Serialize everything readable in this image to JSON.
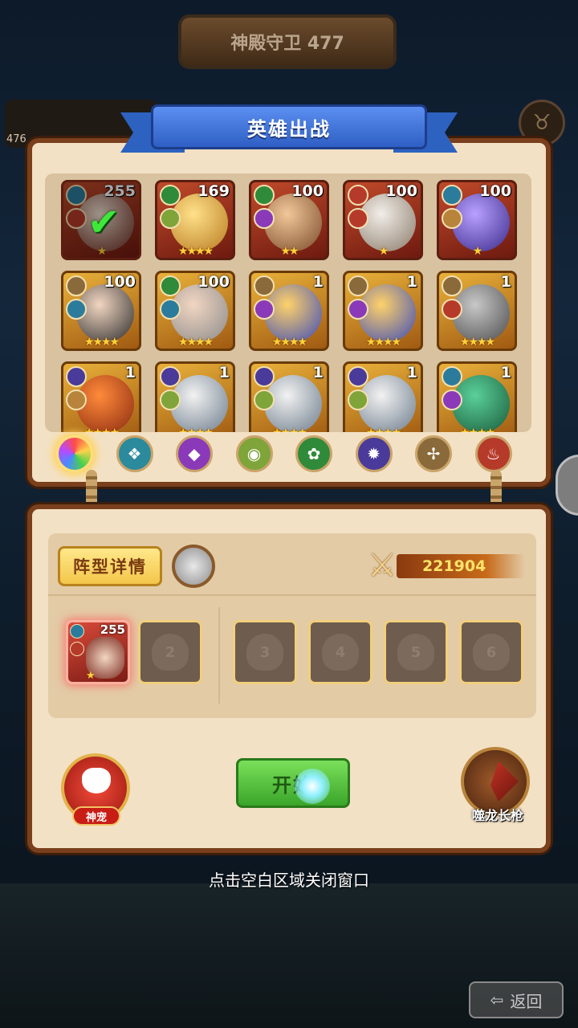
{
  "stage_title": "神殿守卫 477",
  "top_left_value": "476",
  "panel_title": "英雄出战",
  "heroes": [
    {
      "level": "255",
      "stars": "★",
      "selected": true,
      "frame": "red",
      "fac": "#2b7c9c",
      "cls": "#b63a2a",
      "pc1": "#f0e0d0",
      "pc2": "#6a2a20"
    },
    {
      "level": "169",
      "stars": "★★★★",
      "selected": false,
      "frame": "red",
      "fac": "#2f8a3a",
      "cls": "#7ea43a",
      "pc1": "#ffe18a",
      "pc2": "#b87a20"
    },
    {
      "level": "100",
      "stars": "★★",
      "selected": false,
      "frame": "red",
      "fac": "#2f8a3a",
      "cls": "#8a3ab8",
      "pc1": "#f1c89a",
      "pc2": "#7a4a2a"
    },
    {
      "level": "100",
      "stars": "★",
      "selected": false,
      "frame": "red",
      "fac": "#b63a2a",
      "cls": "#b63a2a",
      "pc1": "#f2eee8",
      "pc2": "#8a7a6a"
    },
    {
      "level": "100",
      "stars": "★",
      "selected": false,
      "frame": "red",
      "fac": "#2b7c9c",
      "cls": "#b8833a",
      "pc1": "#b8a0ff",
      "pc2": "#3a2a8a"
    },
    {
      "level": "100",
      "stars": "★★★★",
      "selected": false,
      "frame": "gold",
      "fac": "#8a6a3a",
      "cls": "#2b7c9c",
      "pc1": "#f2d6c2",
      "pc2": "#2a2a2a"
    },
    {
      "level": "100",
      "stars": "★★★★",
      "selected": false,
      "frame": "gold",
      "fac": "#2f8a3a",
      "cls": "#2b7c9c",
      "pc1": "#f2d6c2",
      "pc2": "#8a8a8a"
    },
    {
      "level": "1",
      "stars": "★★★★",
      "selected": false,
      "frame": "gold",
      "fac": "#8a6a3a",
      "cls": "#8a3ab8",
      "pc1": "#ffd26a",
      "pc2": "#3a4ab8"
    },
    {
      "level": "1",
      "stars": "★★★★",
      "selected": false,
      "frame": "gold",
      "fac": "#8a6a3a",
      "cls": "#8a3ab8",
      "pc1": "#ffd26a",
      "pc2": "#3a4ab8"
    },
    {
      "level": "1",
      "stars": "★★★★",
      "selected": false,
      "frame": "gold",
      "fac": "#8a6a3a",
      "cls": "#b63a2a",
      "pc1": "#c8c8c8",
      "pc2": "#4a4a4a"
    },
    {
      "level": "1",
      "stars": "★★★★",
      "selected": false,
      "frame": "gold",
      "fac": "#4a3a9a",
      "cls": "#b8833a",
      "pc1": "#ff8a3a",
      "pc2": "#8a2a10"
    },
    {
      "level": "1",
      "stars": "★★★★",
      "selected": false,
      "frame": "gold",
      "fac": "#4a3a9a",
      "cls": "#7ea43a",
      "pc1": "#f2f2f2",
      "pc2": "#6a7a8a"
    },
    {
      "level": "1",
      "stars": "★★★★",
      "selected": false,
      "frame": "gold",
      "fac": "#4a3a9a",
      "cls": "#7ea43a",
      "pc1": "#f2f2f2",
      "pc2": "#6a7a8a"
    },
    {
      "level": "1",
      "stars": "★★★★",
      "selected": false,
      "frame": "gold",
      "fac": "#4a3a9a",
      "cls": "#7ea43a",
      "pc1": "#f2f2f2",
      "pc2": "#6a7a8a"
    },
    {
      "level": "1",
      "stars": "★★★★",
      "selected": false,
      "frame": "gold",
      "fac": "#2b7c9c",
      "cls": "#8a3ab8",
      "pc1": "#5ad09a",
      "pc2": "#1a5a3a"
    }
  ],
  "filters": [
    {
      "name": "all",
      "color": "conic-gradient(#ff4a4a, #ffd24a, #4ad04a, #4a8aff, #b84aff, #ff4a4a)",
      "glyph": "",
      "active": true
    },
    {
      "name": "faction-1",
      "color": "#2b8a9c",
      "glyph": "❖",
      "active": false
    },
    {
      "name": "faction-2",
      "color": "#8a3ab8",
      "glyph": "◆",
      "active": false
    },
    {
      "name": "faction-3",
      "color": "#7ea43a",
      "glyph": "◉",
      "active": false
    },
    {
      "name": "faction-4",
      "color": "#2f8a3a",
      "glyph": "✿",
      "active": false
    },
    {
      "name": "faction-5",
      "color": "#4a3a9a",
      "glyph": "✹",
      "active": false
    },
    {
      "name": "faction-6",
      "color": "#8a6a3a",
      "glyph": "✢",
      "active": false
    },
    {
      "name": "faction-7",
      "color": "#b63a2a",
      "glyph": "♨",
      "active": false
    }
  ],
  "formation_label": "阵型详情",
  "power_value": "221904",
  "slots": [
    {
      "num": "",
      "filled": true,
      "level": "255",
      "stars": "★"
    },
    {
      "num": "2",
      "filled": false
    },
    {
      "num": "3",
      "filled": false
    },
    {
      "num": "4",
      "filled": false
    },
    {
      "num": "5",
      "filled": false
    },
    {
      "num": "6",
      "filled": false
    }
  ],
  "pet_label": "神宠",
  "start_label": "开始",
  "spear_label": "噬龙长枪",
  "close_hint": "点击空白区域关闭窗口",
  "back_label": "返回"
}
